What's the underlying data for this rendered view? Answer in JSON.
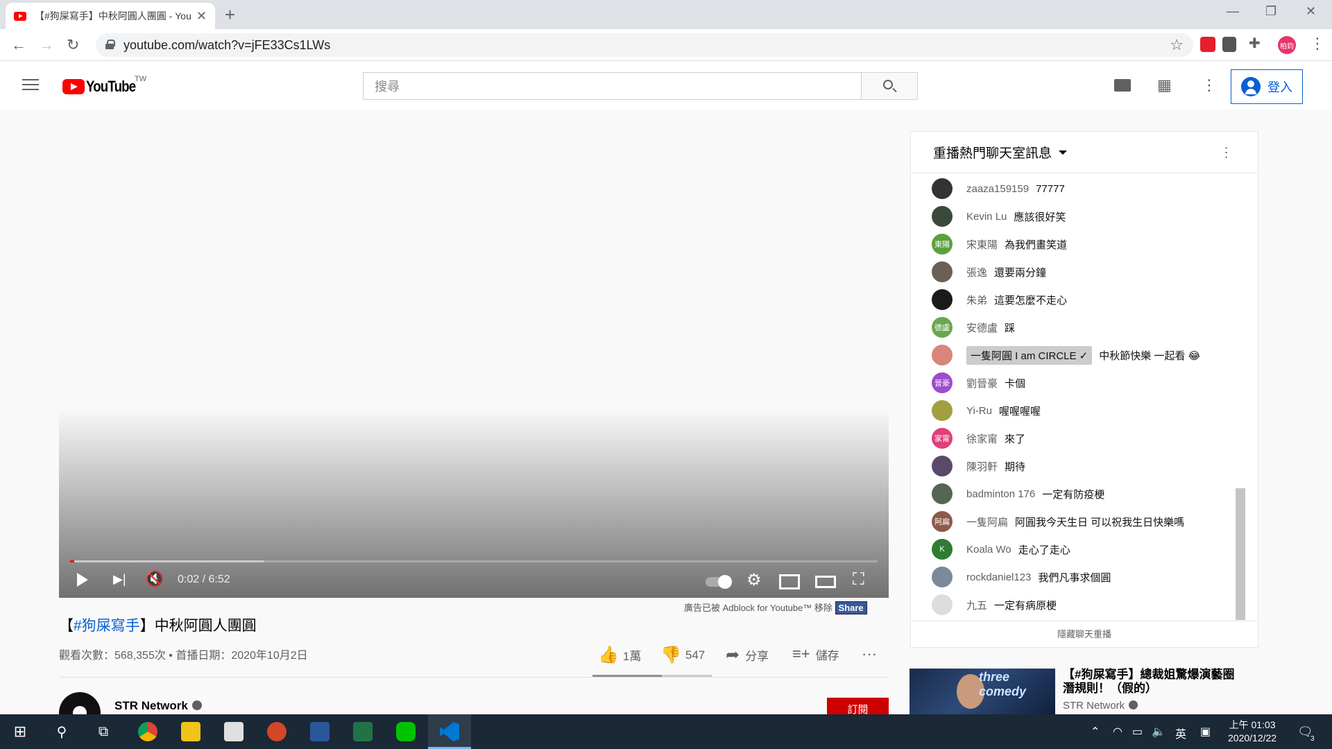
{
  "browser": {
    "tab_title": "【#狗屎寫手】中秋阿圓人團圓 - YouTube",
    "new_tab": "+",
    "url": "youtube.com/watch?v=jFE33Cs1LWs",
    "profile_label": "柏鈞"
  },
  "masthead": {
    "logo_text": "YouTube",
    "country_code": "TW",
    "search_placeholder": "搜尋",
    "signin_label": "登入"
  },
  "player": {
    "current_time": "0:02",
    "duration": "6:52",
    "time_display": "0:02 / 6:52",
    "progress_fraction": 0.005,
    "buffered_fraction": 0.24
  },
  "chat": {
    "header": "重播熱門聊天室訊息",
    "footer": "隱藏聊天重播",
    "messages": [
      {
        "author": "zaaza159159",
        "text": "77777",
        "avatar_color": "#333333",
        "initials": ""
      },
      {
        "author": "Kevin Lu",
        "text": "應該很好笑",
        "avatar_color": "#3a4a3a",
        "initials": ""
      },
      {
        "author": "宋東陽",
        "text": "為我們畫笑道",
        "avatar_color": "#5ca03c",
        "initials": "東陽"
      },
      {
        "author": "張逸",
        "text": "還要兩分鐘",
        "avatar_color": "#6b6055",
        "initials": ""
      },
      {
        "author": "朱弟",
        "text": "這要怎麼不走心",
        "avatar_color": "#1a1a1a",
        "initials": ""
      },
      {
        "author": "安德盧",
        "text": "踩",
        "avatar_color": "#6aa84f",
        "initials": "德盧"
      },
      {
        "author": "一隻阿圓 I am CIRCLE ✓",
        "text": "中秋節快樂 一起看 😂",
        "avatar_color": "#d9857a",
        "initials": "",
        "owner": true
      },
      {
        "author": "劉晉豪",
        "text": "卡個",
        "avatar_color": "#9c4dcc",
        "initials": "晉豪"
      },
      {
        "author": "Yi-Ru",
        "text": "喔喔喔喔",
        "avatar_color": "#a0a040",
        "initials": ""
      },
      {
        "author": "徐家甯",
        "text": "來了",
        "avatar_color": "#e0407a",
        "initials": "家甯"
      },
      {
        "author": "陳羽軒",
        "text": "期待",
        "avatar_color": "#5a4a6a",
        "initials": ""
      },
      {
        "author": "badminton 176",
        "text": "一定有防疫梗",
        "avatar_color": "#556655",
        "initials": ""
      },
      {
        "author": "一隻阿扁",
        "text": "阿圓我今天生日 可以祝我生日快樂嗎",
        "avatar_color": "#8d5a4a",
        "initials": "阿扁"
      },
      {
        "author": "Koala Wo",
        "text": "走心了走心",
        "avatar_color": "#2e7d32",
        "initials": "K"
      },
      {
        "author": "rockdaniel123",
        "text": "我們凡事求個圓",
        "avatar_color": "#7a8a99",
        "initials": ""
      },
      {
        "author": "九五",
        "text": "一定有病原梗",
        "avatar_color": "#dddddd",
        "initials": ""
      }
    ]
  },
  "adblock": {
    "text": "廣告已被 Adblock for Youtube™ 移除",
    "share": "Share"
  },
  "video": {
    "title_tag": "#狗屎寫手",
    "title_rest": "中秋阿圓人團圓",
    "meta": "觀看次數：568,355次 • 首播日期：2020年10月2日",
    "likes": "1萬",
    "dislikes": "547",
    "share_label": "分享",
    "save_label": "儲存",
    "like_fraction": 0.58
  },
  "channel": {
    "name": "STR Network",
    "subscribe": "訂閱"
  },
  "recommended": {
    "title": "【#狗屎寫手】總裁姐驚爆演藝圈潛規則！（假的）",
    "channel": "STR Network",
    "thumb_text": "three comedy"
  },
  "taskbar": {
    "time": "上午 01:03",
    "date": "2020/12/22",
    "ime": "英",
    "notif_count": "3"
  },
  "colors": {
    "brand_red": "#ff0000",
    "link_blue": "#065fd4",
    "taskbar": "#1b2836"
  }
}
